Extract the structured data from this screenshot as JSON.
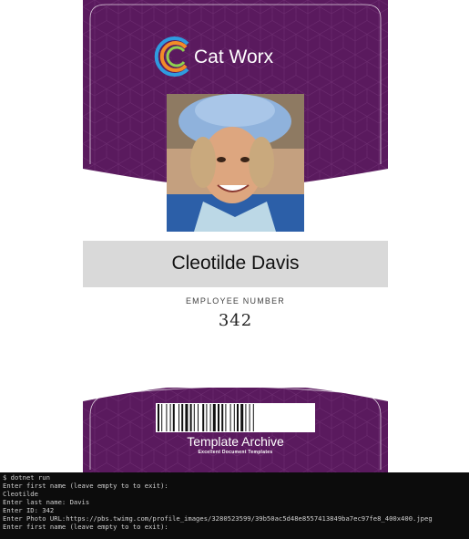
{
  "badge": {
    "company_name": "Cat Worx",
    "employee_name": "Cleotilde Davis",
    "employee_number_label": "EMPLOYEE NUMBER",
    "employee_number": "342",
    "footer_title": "Template Archive",
    "footer_subtitle": "Excellent Document Templates"
  },
  "colors": {
    "brand_purple": "#5a1a5e",
    "brand_purple_dark": "#3a0c41",
    "logo_orange": "#f28c28",
    "logo_blue": "#2f9be0",
    "name_band": "#d9d9d9"
  },
  "icons": {
    "logo": "cat-worx-logo-icon",
    "photo": "employee-photo",
    "barcode": "barcode-icon"
  },
  "terminal": {
    "lines": [
      "$ dotnet run",
      "Enter first name (leave empty to to exit):",
      "Cleotilde",
      "Enter last name: Davis",
      "Enter ID: 342",
      "Enter Photo URL:https://pbs.twimg.com/profile_images/3280523599/39b50ac5d48e8557413849ba7ec97fe8_400x400.jpeg",
      "Enter first name (leave empty to to exit):"
    ]
  }
}
